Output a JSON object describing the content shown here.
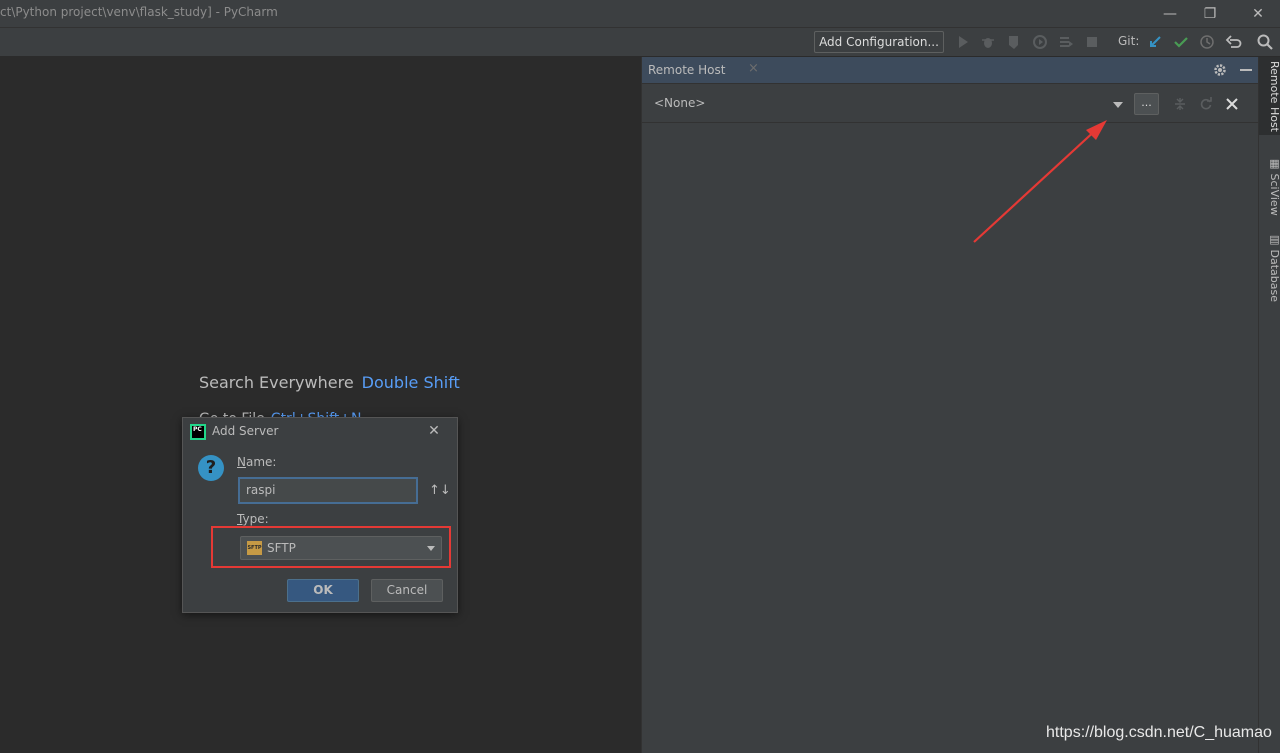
{
  "window": {
    "title": "ct\\Python project\\venv\\flask_study] - PyCharm",
    "minimize": "—",
    "restore": "❐",
    "close": "✕"
  },
  "toolbar": {
    "add_configuration": "Add Configuration...",
    "git_label": "Git:",
    "icons": [
      "run-icon",
      "debug-icon",
      "coverage-icon",
      "profile-icon",
      "concurrency-icon",
      "stop-icon",
      "git-update-icon",
      "git-commit-icon",
      "git-history-icon",
      "git-rollback-icon",
      "search-icon"
    ]
  },
  "editor": {
    "search_everywhere": "Search Everywhere",
    "search_everywhere_key": "Double Shift",
    "goto_file": "Go to File",
    "goto_file_key": "Ctrl+Shift+N"
  },
  "remote_host": {
    "title": "Remote Host",
    "tab_close": "×",
    "selection": "<None>",
    "browse": "...",
    "settings_icon": "gear-icon",
    "hide_icon": "minus-icon"
  },
  "stripe": {
    "tabs": [
      "Remote Host",
      "SciView",
      "Database"
    ]
  },
  "dialog": {
    "title": "Add Server",
    "close": "✕",
    "name_label_mnemonic": "N",
    "name_label_rest": "ame:",
    "name_value": "raspi",
    "type_label_mnemonic": "T",
    "type_label_rest": "ype:",
    "type_icon_text": "SFTP",
    "type_value": "SFTP",
    "ok": "OK",
    "cancel": "Cancel",
    "question": "?"
  },
  "watermark": "https://blog.csdn.net/C_huamao",
  "colors": {
    "annotation_red": "#e53935",
    "link_blue": "#589df6",
    "pycharm_green": "#21d789"
  }
}
